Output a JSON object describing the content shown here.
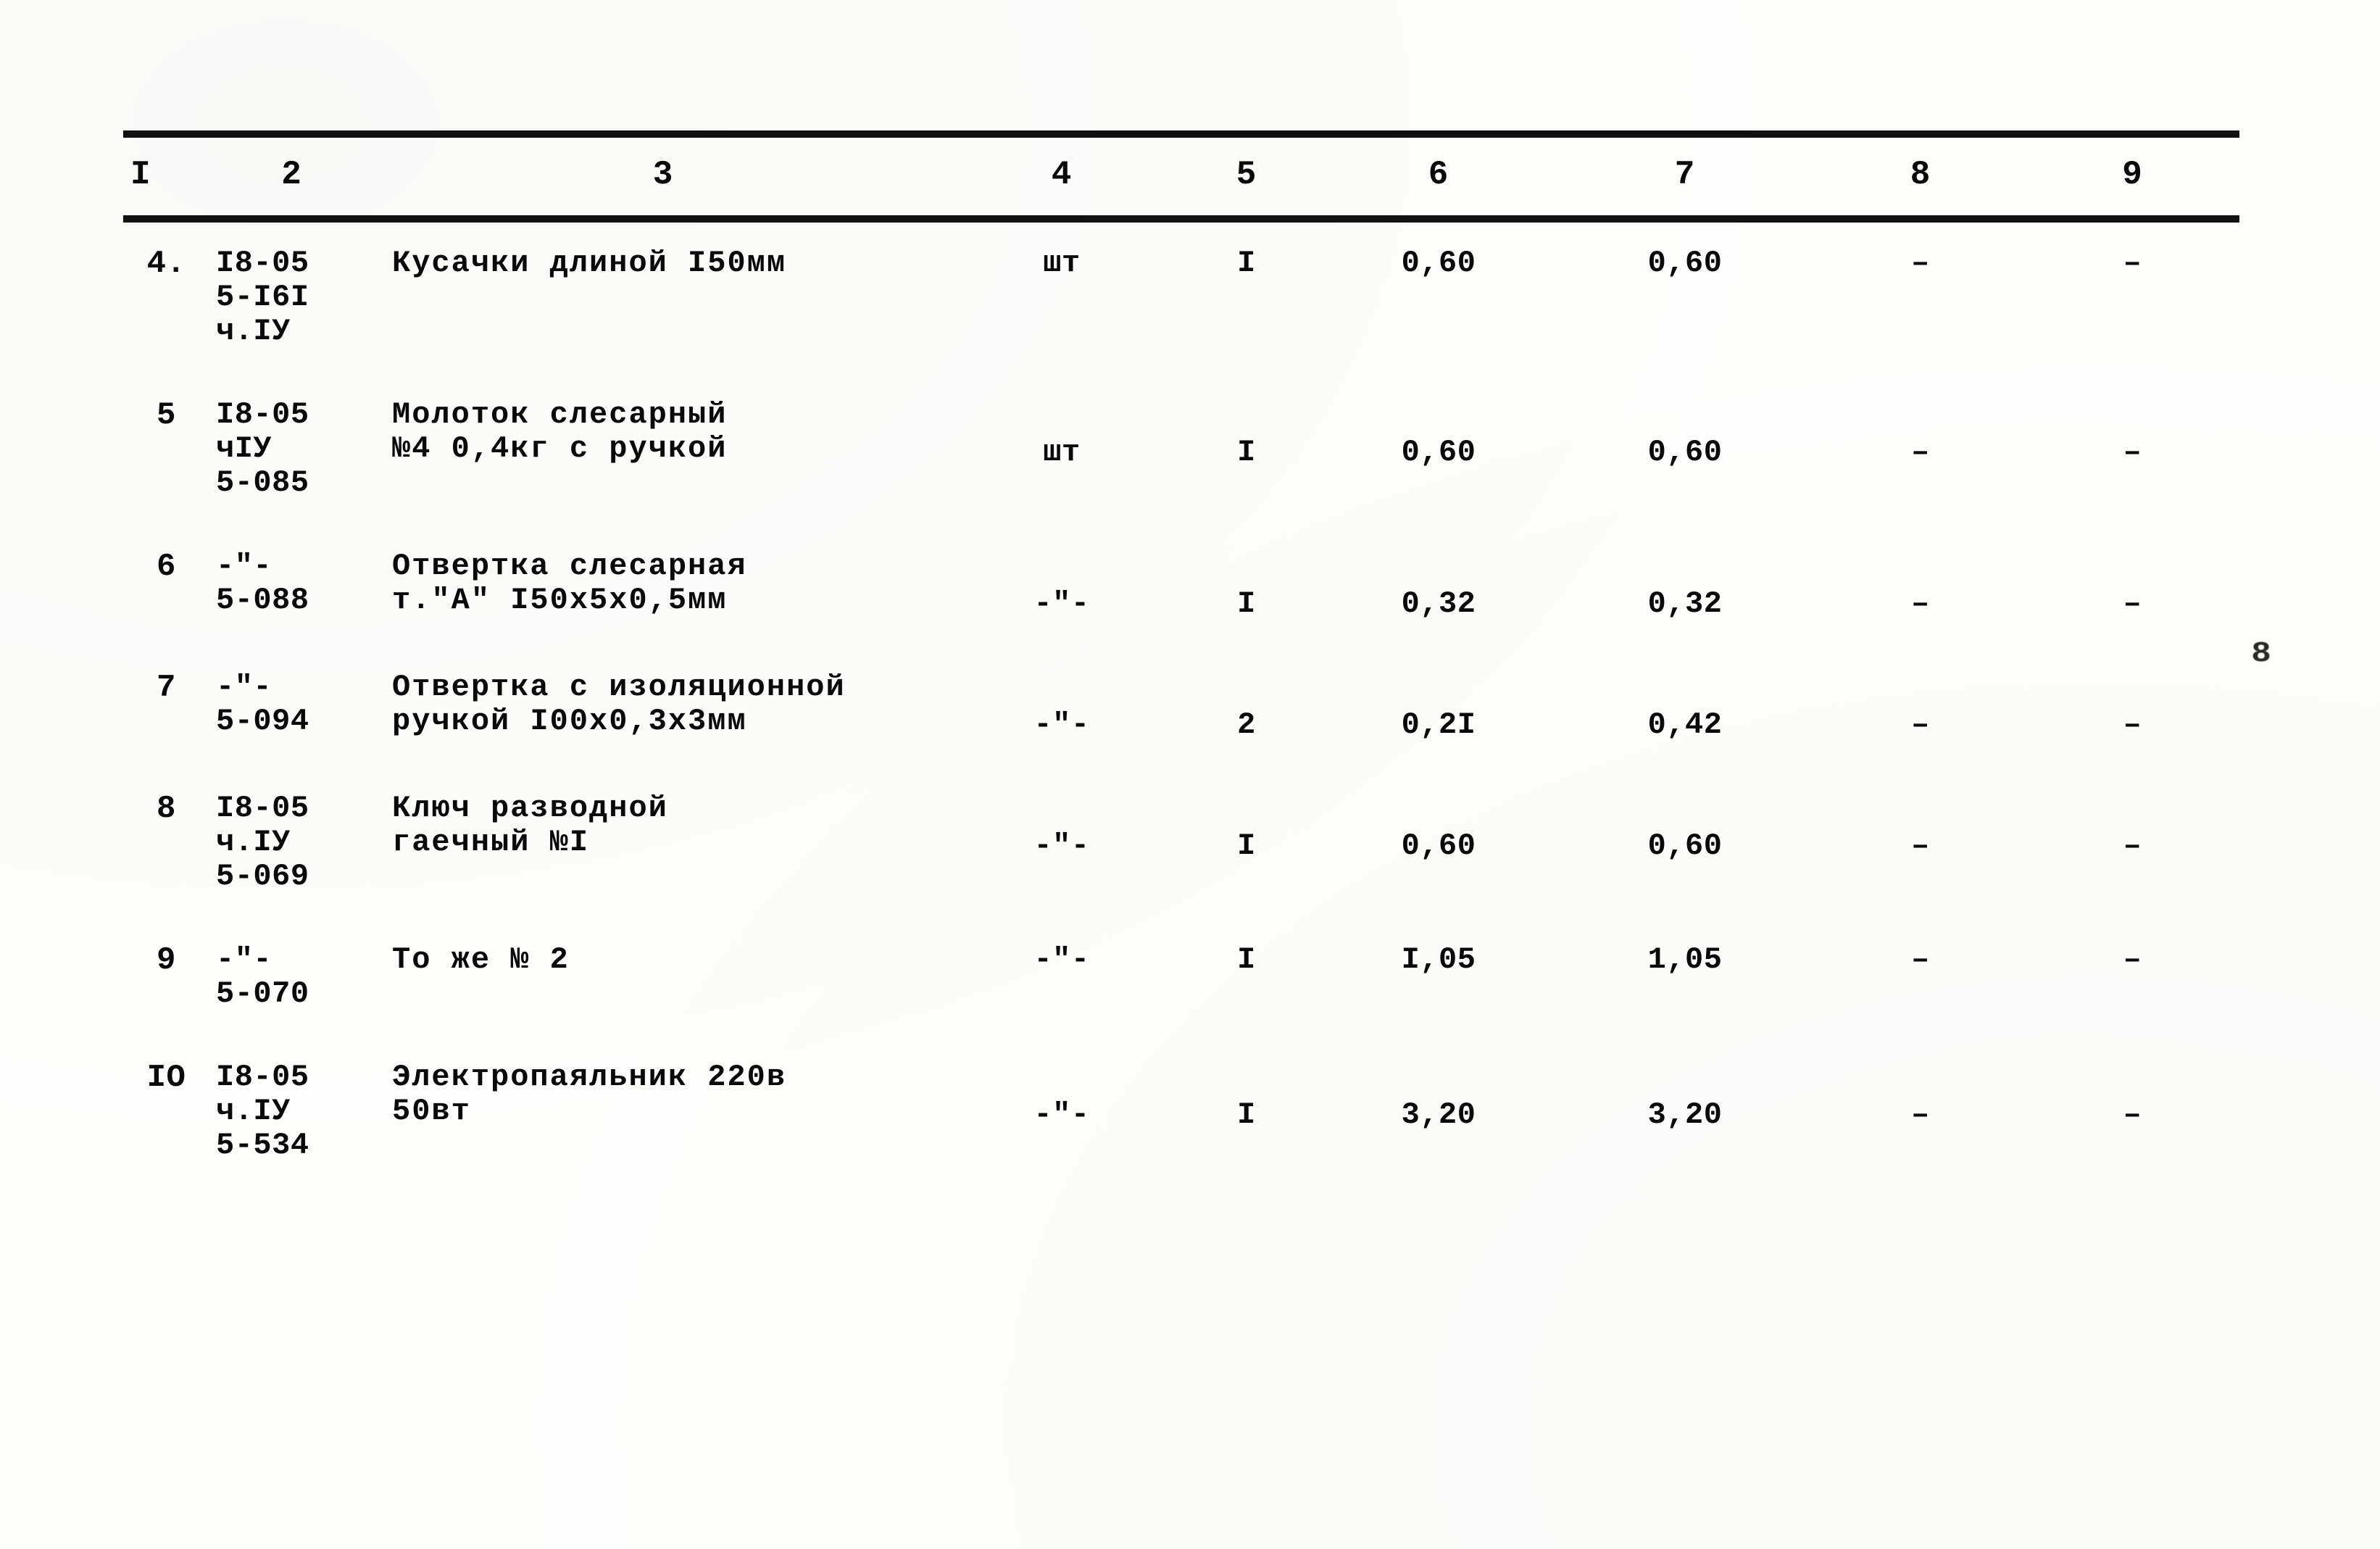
{
  "document": {
    "type": "scanned-estimate-table",
    "page_mark": "8"
  },
  "table": {
    "headers": [
      "I",
      "2",
      "3",
      "4",
      "5",
      "6",
      "7",
      "8",
      "9"
    ],
    "rows": [
      {
        "no": "4.",
        "code": "I8-05\n5-I6I\nч.IУ",
        "name": "Кусачки длиной I50мм",
        "unit": "шт",
        "qty": "I",
        "price": "0,60",
        "sum": "0,60",
        "col8": "–",
        "col9": "–"
      },
      {
        "no": "5",
        "code": "I8-05\nчIУ\n5-085",
        "name": "Молоток слесарный\n№4 0,4кг с ручкой",
        "unit": "шт",
        "qty": "I",
        "price": "0,60",
        "sum": "0,60",
        "col8": "–",
        "col9": "–"
      },
      {
        "no": "6",
        "code": "-\"-\n5-088",
        "name": "Отвертка слесарная\nт.\"А\" I50x5x0,5мм",
        "unit": "-\"-",
        "qty": "I",
        "price": "0,32",
        "sum": "0,32",
        "col8": "–",
        "col9": "–"
      },
      {
        "no": "7",
        "code": "-\"-\n5-094",
        "name": "Отвертка с изоляционной\nручкой I00x0,3x3мм",
        "unit": "-\"-",
        "qty": "2",
        "price": "0,2I",
        "sum": "0,42",
        "col8": "–",
        "col9": "–"
      },
      {
        "no": "8",
        "code": "I8-05\nч.IУ\n5-069",
        "name": "Ключ разводной\nгаечный №I",
        "unit": "-\"-",
        "qty": "I",
        "price": "0,60",
        "sum": "0,60",
        "col8": "–",
        "col9": "–"
      },
      {
        "no": "9",
        "code": "-\"-\n5-070",
        "name": "То же № 2",
        "unit": "-\"-",
        "qty": "I",
        "price": "I,05",
        "sum": "1,05",
        "col8": "–",
        "col9": "–"
      },
      {
        "no": "IO",
        "code": "I8-05\nч.IУ\n5-534",
        "name": "Электропаяльник 220в\n50вт",
        "unit": "-\"-",
        "qty": "I",
        "price": "3,20",
        "sum": "3,20",
        "col8": "–",
        "col9": "–"
      }
    ]
  }
}
